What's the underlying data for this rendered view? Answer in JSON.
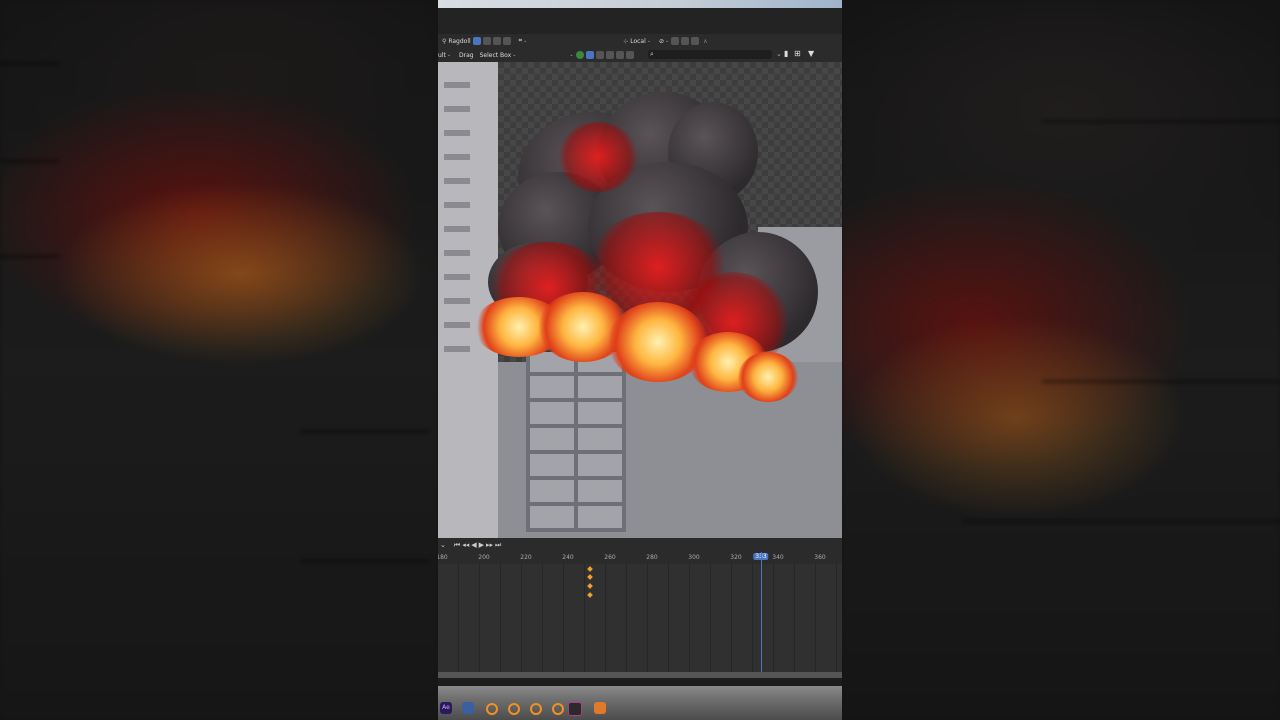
{
  "toolbar": {
    "tool_mode": "Ragdoll",
    "orientation": "Local",
    "drag_label": "Drag",
    "drag_value": "Select Box",
    "left_cut": "ult"
  },
  "timeline": {
    "frames": [
      "180",
      "200",
      "220",
      "240",
      "260",
      "280",
      "300",
      "320",
      "333",
      "340",
      "360"
    ],
    "current_frame": "333"
  },
  "dock": {
    "ae_label": "Ae"
  },
  "colors": {
    "accent": "#4a74c4",
    "keyframe": "#f0a030"
  }
}
